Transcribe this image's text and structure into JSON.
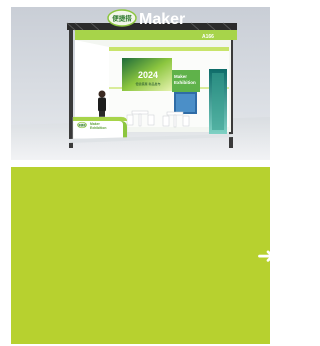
{
  "booth_image": {
    "brand_cn": "便捷搭",
    "brand_en": "Maker",
    "booth_code": "A166",
    "screen_year": "2024",
    "screen_subtitle": "便捷搭展 新品发布",
    "screen_title_line1": "Maker",
    "screen_title_line2": "Exhibition",
    "desk_logo": "便捷搭",
    "desk_title_line1": "Maker",
    "desk_title_line2": "Exhibition"
  },
  "panel": {
    "background": "#b7d12f",
    "arrow_icon": "arrow-right-icon",
    "arrow_glyph": "➜"
  }
}
